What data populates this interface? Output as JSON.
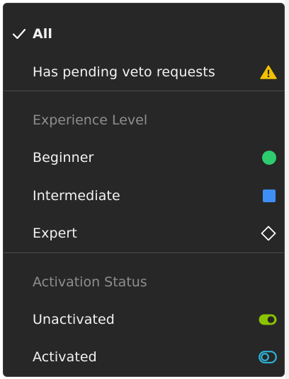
{
  "menu": {
    "all": {
      "label": "All",
      "selected": true
    },
    "pending": {
      "label": "Has pending veto requests",
      "icon": "warning-icon",
      "color": "#f2c100"
    },
    "experience": {
      "header": "Experience Level",
      "items": [
        {
          "label": "Beginner",
          "icon": "green-circle-icon",
          "color": "#2ecc6f"
        },
        {
          "label": "Intermediate",
          "icon": "blue-square-icon",
          "color": "#3f8ef5"
        },
        {
          "label": "Expert",
          "icon": "diamond-outline-icon",
          "color": "#ffffff"
        }
      ]
    },
    "activation": {
      "header": "Activation Status",
      "items": [
        {
          "label": "Unactivated",
          "icon": "toggle-on-icon",
          "color": "#8bc400"
        },
        {
          "label": "Activated",
          "icon": "toggle-off-icon",
          "color": "#2bb5d8"
        }
      ]
    }
  }
}
